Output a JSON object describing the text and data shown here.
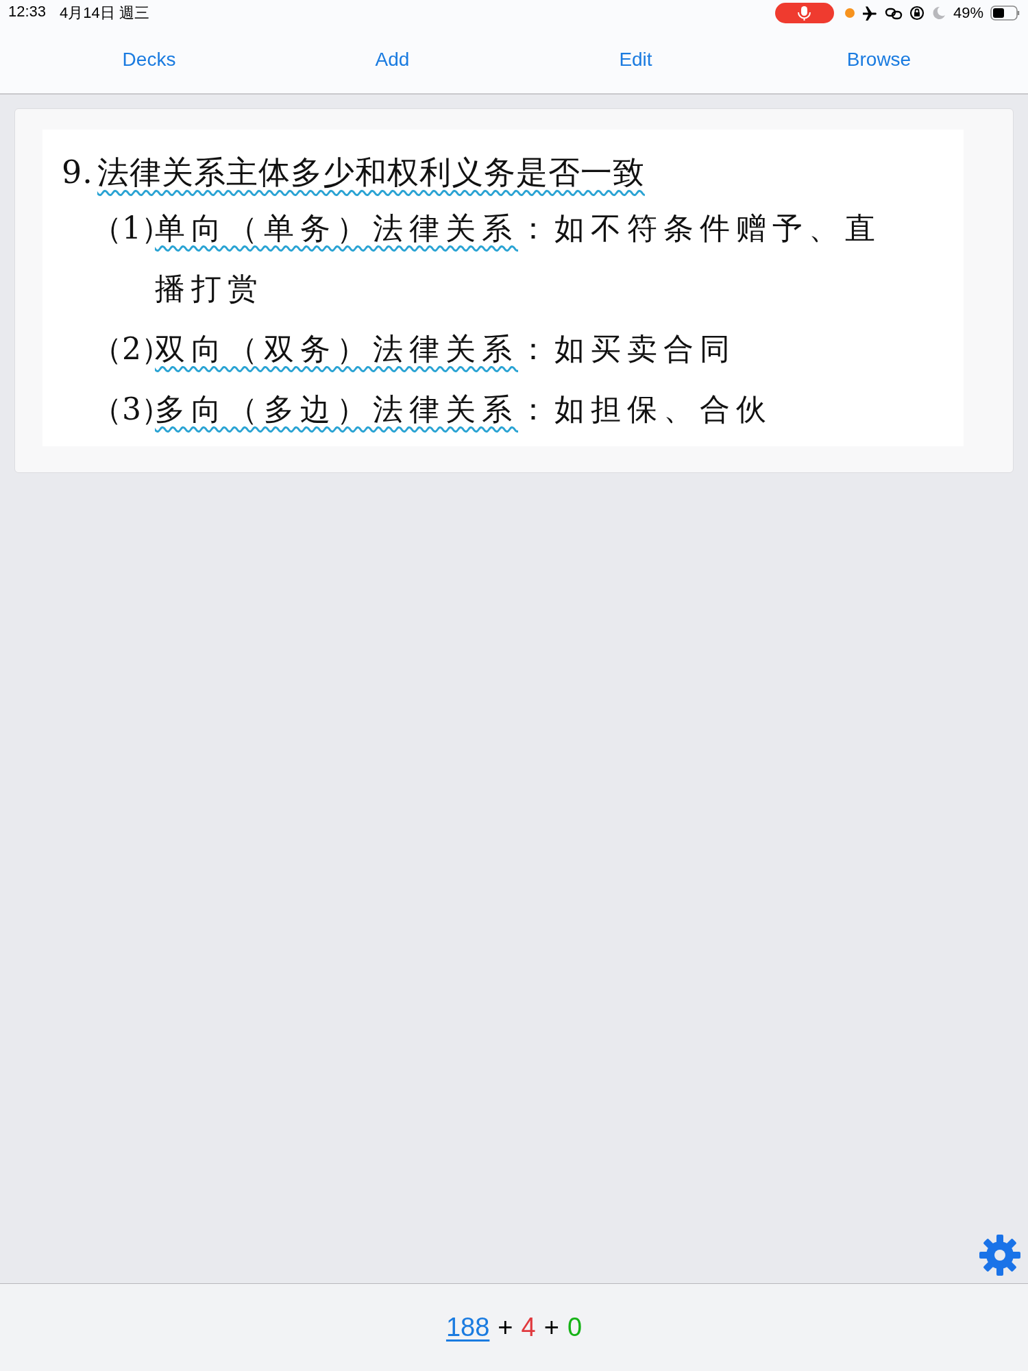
{
  "status_bar": {
    "time": "12:33",
    "date": "4月14日 週三",
    "battery": "49%"
  },
  "nav": {
    "buttons": [
      "Decks",
      "Add",
      "Edit",
      "Browse"
    ]
  },
  "card": {
    "title_number": "9.",
    "title": "法律关系主体多少和权利义务是否一致",
    "items": [
      {
        "number": "（1）",
        "term": "单向（单务）法律关系",
        "rest": "：如不符条件赠予、直播打赏"
      },
      {
        "number": "（2）",
        "term": "双向（双务）法律关系",
        "rest": "：如买卖合同"
      },
      {
        "number": "（3）",
        "term": "多向（多边）法律关系",
        "rest": "：如担保、合伙"
      }
    ]
  },
  "counts": [
    {
      "kind": "link",
      "text": "188",
      "color": "#1a7be0"
    },
    {
      "kind": "plain",
      "text": "+"
    },
    {
      "kind": "count",
      "text": "4",
      "color": "#e0393e"
    },
    {
      "kind": "plain",
      "text": "+"
    },
    {
      "kind": "count",
      "text": "0",
      "color": "#17b317"
    }
  ]
}
